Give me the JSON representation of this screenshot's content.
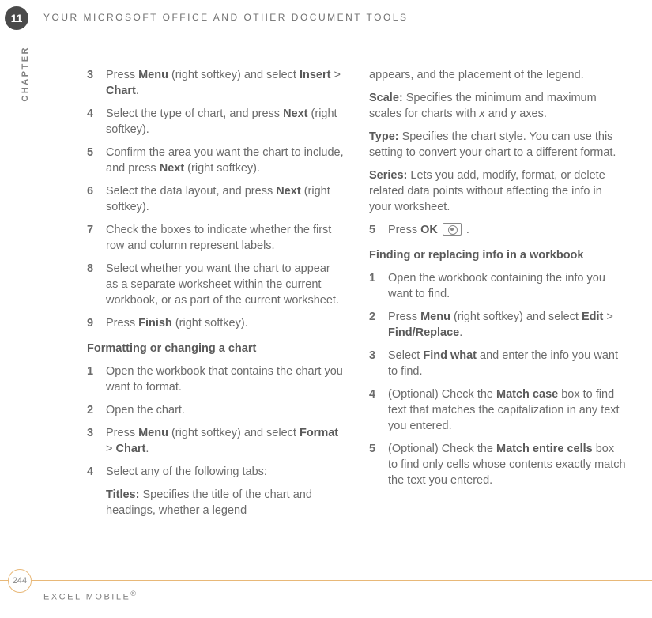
{
  "header": {
    "chapter_number": "11",
    "chapter_label": "CHAPTER",
    "title": "YOUR MICROSOFT OFFICE AND OTHER DOCUMENT TOOLS"
  },
  "left": {
    "items": [
      {
        "n": "3",
        "pre": "Press ",
        "b1": "Menu",
        "mid1": " (right softkey) and select ",
        "b2": "Insert",
        "mid2": " > ",
        "b3": "Chart",
        "post": "."
      },
      {
        "n": "4",
        "pre": "Select the type of chart, and press ",
        "b1": "Next",
        "post": " (right softkey)."
      },
      {
        "n": "5",
        "pre": "Confirm the area you want the chart to include, and press ",
        "b1": "Next",
        "post": " (right softkey)."
      },
      {
        "n": "6",
        "pre": "Select the data layout, and press ",
        "b1": "Next",
        "post": " (right softkey)."
      },
      {
        "n": "7",
        "t": "Check the boxes to indicate whether the first row and column represent labels."
      },
      {
        "n": "8",
        "t": "Select whether you want the chart to appear as a separate worksheet within the current workbook, or as part of the current worksheet."
      },
      {
        "n": "9",
        "pre": "Press ",
        "b1": "Finish",
        "post": " (right softkey)."
      }
    ],
    "section2_head": "Formatting or changing a chart",
    "section2_items": [
      {
        "n": "1",
        "t": "Open the workbook that contains the chart you want to format."
      },
      {
        "n": "2",
        "t": "Open the chart."
      },
      {
        "n": "3",
        "pre": "Press ",
        "b1": "Menu",
        "mid1": " (right softkey) and select ",
        "b2": "Format",
        "mid2": " > ",
        "b3": "Chart",
        "post": "."
      },
      {
        "n": "4",
        "t": "Select any of the following tabs:"
      }
    ],
    "titles_label": "Titles:",
    "titles_text": " Specifies the title of the chart and headings, whether a legend"
  },
  "right": {
    "cont": "appears, and the placement of the legend.",
    "scale_label": "Scale:",
    "scale_text_a": " Specifies the minimum and maximum scales for charts with ",
    "scale_x": "x",
    "scale_text_b": " and ",
    "scale_y": "y",
    "scale_text_c": " axes.",
    "type_label": "Type:",
    "type_text": " Specifies the chart style. You can use this setting to convert your chart to a different format.",
    "series_label": "Series:",
    "series_text": " Lets you add, modify, format, or delete related data points without affecting the info in your worksheet.",
    "item5_pre": "Press ",
    "item5_b": "OK",
    "item5_n": "5",
    "item5_post": " .",
    "section3_head": "Finding or replacing info in a workbook",
    "section3_items": [
      {
        "n": "1",
        "t": "Open the workbook containing the info you want to find."
      },
      {
        "n": "2",
        "pre": "Press ",
        "b1": "Menu",
        "mid1": " (right softkey) and select ",
        "b2": "Edit",
        "mid2": " > ",
        "b3": "Find/Replace",
        "post": "."
      },
      {
        "n": "3",
        "pre": "Select ",
        "b1": "Find what",
        "post": " and enter the info you want to find."
      },
      {
        "n": "4",
        "pre": "(Optional) Check the ",
        "b1": "Match case",
        "post": " box to find text that matches the capitalization in any text you entered."
      },
      {
        "n": "5",
        "pre": "(Optional) Check the ",
        "b1": "Match entire cells",
        "post": " box to find only cells whose contents exactly match the text you entered."
      }
    ]
  },
  "footer": {
    "page": "244",
    "title": "EXCEL MOBILE",
    "reg": "®"
  }
}
